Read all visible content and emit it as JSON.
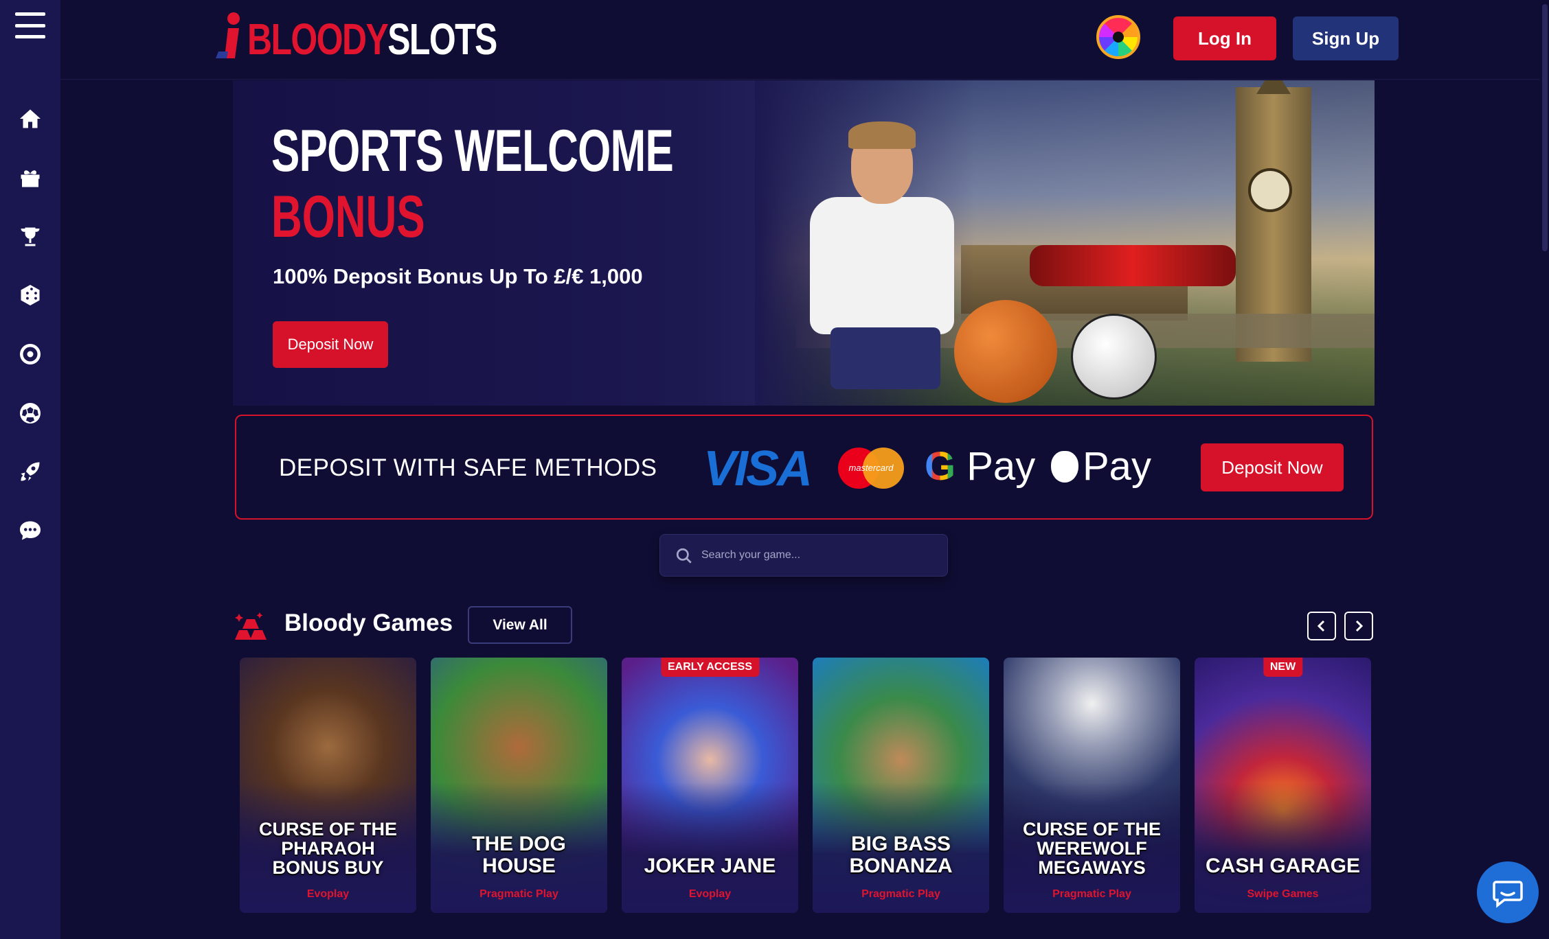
{
  "brand": {
    "name_part1": "BLOODY",
    "name_part2": "SLOTS",
    "color_red": "#e0142e"
  },
  "header": {
    "login_label": "Log In",
    "signup_label": "Sign Up",
    "wheel_icon": "prize-wheel-icon"
  },
  "sidebar": {
    "menu_icon": "hamburger-menu-icon",
    "items": [
      {
        "icon": "home-icon"
      },
      {
        "icon": "gift-icon"
      },
      {
        "icon": "trophy-icon"
      },
      {
        "icon": "dice-icon"
      },
      {
        "icon": "roulette-icon"
      },
      {
        "icon": "soccer-ball-icon"
      },
      {
        "icon": "rocket-icon"
      },
      {
        "icon": "chat-bubble-icon"
      }
    ]
  },
  "hero": {
    "title_line1": "SPORTS WELCOME",
    "title_line2": "BONUS",
    "subtitle": "100% Deposit Bonus Up To £/€ 1,000",
    "cta_label": "Deposit Now"
  },
  "deposit_band": {
    "text": "DEPOSIT WITH SAFE METHODS",
    "methods": {
      "visa": "VISA",
      "mastercard": "mastercard",
      "gpay": "Pay",
      "applepay": "Pay"
    },
    "cta_label": "Deposit Now"
  },
  "search": {
    "placeholder": "Search your game..."
  },
  "games_section": {
    "title": "Bloody Games",
    "view_all_label": "View All",
    "games": [
      {
        "title": "CURSE OF THE PHARAOH BONUS BUY",
        "provider": "Evoplay",
        "badge": ""
      },
      {
        "title": "THE DOG HOUSE",
        "provider": "Pragmatic Play",
        "badge": ""
      },
      {
        "title": "JOKER JANE",
        "provider": "Evoplay",
        "badge": "EARLY ACCESS"
      },
      {
        "title": "BIG BASS BONANZA",
        "provider": "Pragmatic Play",
        "badge": ""
      },
      {
        "title": "CURSE OF THE WEREWOLF MEGAWAYS",
        "provider": "Pragmatic Play",
        "badge": ""
      },
      {
        "title": "CASH GARAGE",
        "provider": "Swipe Games",
        "badge": "NEW"
      }
    ]
  },
  "chat": {
    "icon": "live-chat-icon"
  }
}
